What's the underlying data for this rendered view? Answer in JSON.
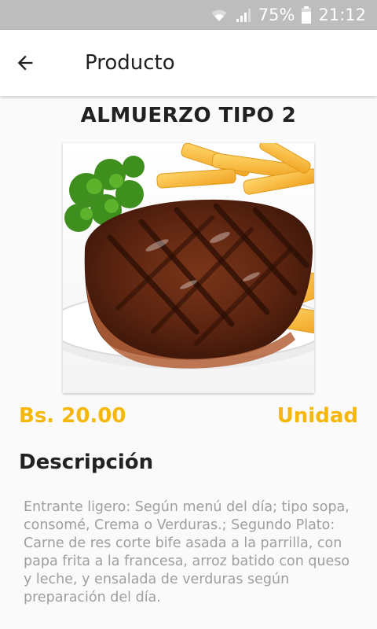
{
  "status_bar": {
    "battery": "75%",
    "time": "21:12",
    "icons": [
      "wifi-icon",
      "signal-icon",
      "battery-icon"
    ]
  },
  "app_bar": {
    "title": "Producto",
    "back_icon": "arrow-back-icon"
  },
  "product": {
    "name": "ALMUERZO TIPO 2",
    "image": "grilled-steak-with-fries-and-parsley",
    "price": "Bs. 20.00",
    "unit": "Unidad",
    "description_heading": "Descripción",
    "description": "Entrante ligero: Según menú del día; tipo sopa, consomé, Crema o Verduras.; Segundo Plato: Carne de res corte bife asada a la parrilla, con papa frita a la francesa, arroz batido con queso y leche, y ensalada de verduras según preparación del día."
  },
  "colors": {
    "status_bar_bg": "#bdbdbd",
    "accent": "#f6b70a",
    "text_primary": "#212121",
    "text_secondary": "#9e9e9e",
    "background": "#fafafa"
  }
}
